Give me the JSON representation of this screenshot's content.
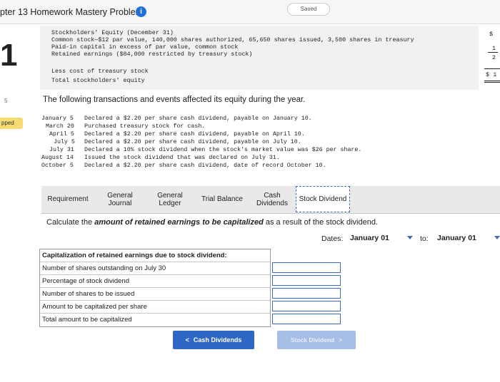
{
  "header": {
    "title": "pter 13 Homework Mastery Problem",
    "info_glyph": "i",
    "saved_label": "Saved"
  },
  "sidebar": {
    "question_number": "1",
    "tick_mark": "5",
    "skipped_label": "pped"
  },
  "equity": {
    "lines": [
      "Stockholders' Equity (December 31)",
      "Common stock—$12 par value, 140,000 shares authorized, 65,650 shares issued, 3,500 shares in treasury",
      "Paid-in capital in excess of par value, common stock",
      "Retained earnings ($84,000 restricted by treasury stock)",
      "Less cost of treasury stock",
      "Total stockholders' equity"
    ],
    "right_dollar": "$",
    "right_frac_top": "1",
    "right_frac_bottom": "2",
    "right_total": "$ 1"
  },
  "intro": "The following transactions and events affected its equity during the year.",
  "transactions": [
    {
      "date": "January 5",
      "text": "Declared a $2.20 per share cash dividend, payable on January 10."
    },
    {
      "date": "March 20",
      "text": "Purchased treasury stock for cash."
    },
    {
      "date": "April 5",
      "text": "Declared a $2.20 per share cash dividend, payable on April 10."
    },
    {
      "date": "July 5",
      "text": "Declared a $2.20 per share cash dividend, payable on July 10."
    },
    {
      "date": "July 31",
      "text": "Declared a 10% stock dividend when the stock's market value was $26 per share."
    },
    {
      "date": "August 14",
      "text": "Issued the stock dividend that was declared on July 31."
    },
    {
      "date": "October 5",
      "text": "Declared a $2.20 per share cash dividend, date of record October 10."
    }
  ],
  "tabs": [
    {
      "label": "Requirement"
    },
    {
      "label": "General Journal"
    },
    {
      "label": "General Ledger"
    },
    {
      "label": "Trial Balance"
    },
    {
      "label": "Cash Dividends"
    },
    {
      "label": "Stock Dividend"
    }
  ],
  "instruction": {
    "pre": "Calculate the ",
    "emph": "amount of retained earnings to be capitalized",
    "post": " as a result of the stock dividend."
  },
  "dates": {
    "label": "Dates:",
    "from_value": "January 01",
    "to_label": "to:",
    "to_value": "January 01"
  },
  "capitalization": {
    "header": "Capitalization of retained earnings due to stock dividend:",
    "rows": [
      {
        "label": "Number of shares outstanding on July 30",
        "value": ""
      },
      {
        "label": "Percentage of stock dividend",
        "value": ""
      },
      {
        "label": "Number of shares to be issued",
        "value": ""
      },
      {
        "label": "Amount to be capitalized per share",
        "value": ""
      },
      {
        "label": "Total amount to be capitalized",
        "value": ""
      }
    ]
  },
  "nav": {
    "prev_label": "Cash Dividends",
    "prev_glyph": "<",
    "next_label": "Stock Dividend",
    "next_glyph": ">"
  },
  "colors": {
    "accent": "#2f67c4",
    "skipped": "#f5dc72",
    "info": "#1f6fd6"
  }
}
